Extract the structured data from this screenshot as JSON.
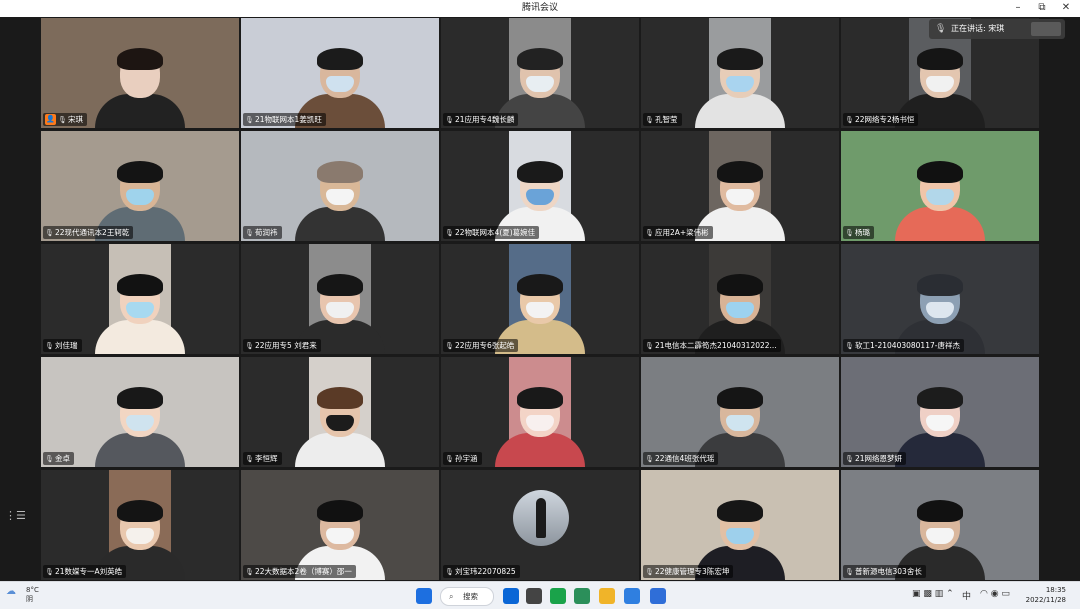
{
  "window": {
    "title": "腾讯会议",
    "controls": {
      "minimize": "–",
      "restore": "⧉",
      "close": "✕"
    }
  },
  "speaking_indicator": {
    "label": "正在讲话: 宋琪"
  },
  "participants": [
    {
      "name": "宋琪",
      "host": true,
      "bg": "#7d6b5b",
      "skin": "#e9cfbf",
      "hair": "#1d1512",
      "shirt": "#222",
      "mask": "",
      "layout": "full"
    },
    {
      "name": "21物联网本1姜凯旺",
      "bg": "#c9cdd6",
      "skin": "#d9b79d",
      "hair": "#1b1b1b",
      "shirt": "#6b4e3a",
      "mask": "#cfe1ef",
      "layout": "full"
    },
    {
      "name": "21应用专4魏长麟",
      "bg": "#8b8b8b",
      "skin": "#e0c3ad",
      "hair": "#222",
      "shirt": "#444",
      "mask": "#e8eef2",
      "layout": "narrow"
    },
    {
      "name": "孔智莹",
      "bg": "#9a9c9e",
      "skin": "#e7cdb8",
      "hair": "#1a1a1a",
      "shirt": "#e3e3e3",
      "mask": "#a9d4ef",
      "layout": "narrow"
    },
    {
      "name": "22网络专2杨书恒",
      "bg": "#5b5d60",
      "skin": "#e3c6b0",
      "hair": "#151515",
      "shirt": "#1f1f1f",
      "mask": "#f1f1f1",
      "layout": "narrow"
    },
    {
      "name": "22现代通讯本2王轲乾",
      "bg": "#a59b8f",
      "skin": "#d8b596",
      "hair": "#141414",
      "shirt": "#5f6c74",
      "mask": "#9fd3ec",
      "layout": "full"
    },
    {
      "name": "荀润祎",
      "bg": "#b5b9be",
      "skin": "#d9b898",
      "hair": "#8a7a6e",
      "shirt": "#333",
      "mask": "#f4f4f4",
      "layout": "full"
    },
    {
      "name": "22物联网本4(夏)葛婉佳",
      "bg": "#d8dbe0",
      "skin": "#eed6c5",
      "hair": "#1a1a1a",
      "shirt": "#f1f1f1",
      "mask": "#6aa3d8",
      "layout": "narrow"
    },
    {
      "name": "应用2A+梁伟彬",
      "bg": "#6d6660",
      "skin": "#e0bba0",
      "hair": "#141414",
      "shirt": "#f0f0f0",
      "mask": "#f4f4f4",
      "layout": "narrow"
    },
    {
      "name": "杨璐",
      "bg": "#6f9b6b",
      "skin": "#f0c5a9",
      "hair": "#111",
      "shirt": "#e66a58",
      "mask": "#b2d7ea",
      "layout": "full"
    },
    {
      "name": "刘佳瑞",
      "bg": "#c6bfb6",
      "skin": "#f0d2be",
      "hair": "#121212",
      "shirt": "#f3eadf",
      "mask": "#a7d9f0",
      "layout": "narrow"
    },
    {
      "name": "22应用专5 刘君来",
      "bg": "#8c8c8c",
      "skin": "#e8c5ae",
      "hair": "#161616",
      "shirt": "#2b2b2b",
      "mask": "#f0f0f0",
      "layout": "narrow"
    },
    {
      "name": "22应用专6张起皓",
      "bg": "#556c88",
      "skin": "#e9c9a9",
      "hair": "#191919",
      "shirt": "#d4bc8a",
      "mask": "#f3f3f3",
      "layout": "narrow"
    },
    {
      "name": "21电信本二霹笱杰21040312022...",
      "bg": "#3c3a38",
      "skin": "#d8b396",
      "hair": "#121212",
      "shirt": "#1f1f1f",
      "mask": "#9dd2ef",
      "layout": "narrow"
    },
    {
      "name": "软工1-210403080117-唐祥杰",
      "bg": "#37393d",
      "skin": "#8da0b4",
      "hair": "#2a2d33",
      "shirt": "#2e3035",
      "mask": "#dde6ef",
      "layout": "full"
    },
    {
      "name": "金卓",
      "bg": "#c7c4c0",
      "skin": "#f2d6c3",
      "hair": "#181818",
      "shirt": "#55585e",
      "mask": "#cfe3ef",
      "layout": "full"
    },
    {
      "name": "李恒辉",
      "bg": "#d5d0cb",
      "skin": "#e6c5ac",
      "hair": "#5a3a26",
      "shirt": "#ededed",
      "mask": "#1c1c1c",
      "layout": "narrow"
    },
    {
      "name": "孙宇涵",
      "bg": "#cc8c8e",
      "skin": "#f3d4c7",
      "hair": "#191919",
      "shirt": "#c8484e",
      "mask": "#f8f0ef",
      "layout": "narrow"
    },
    {
      "name": "22通信4班张代瑶",
      "bg": "#7b7e82",
      "skin": "#d8b79d",
      "hair": "#151515",
      "shirt": "#3b3c3e",
      "mask": "#cfe4ef",
      "layout": "full"
    },
    {
      "name": "21网络恩梦妍",
      "bg": "#6c6e76",
      "skin": "#efd0c6",
      "hair": "#1c1c1c",
      "shirt": "#25293a",
      "mask": "#f6f6f6",
      "layout": "full"
    },
    {
      "name": "21数媒专一A刘英皓",
      "bg": "#8a6b57",
      "skin": "#e9c8ae",
      "hair": "#141414",
      "shirt": "#2a2a2a",
      "mask": "#f5f1ec",
      "layout": "narrow"
    },
    {
      "name": "22大数据本2卷（博赛）邵一",
      "bg": "#4d4a47",
      "skin": "#ddb9a0",
      "hair": "#111",
      "shirt": "#f2f2f2",
      "mask": "#f5f5f5",
      "layout": "full"
    },
    {
      "name": "刘宝玮22070825",
      "bg": "#2b2b2b",
      "avatar": true,
      "layout": "avatar"
    },
    {
      "name": "22健康管理专3陈宏坤",
      "bg": "#c9c0b2",
      "skin": "#e2c0a5",
      "hair": "#161616",
      "shirt": "#1e1e24",
      "mask": "#9ed0ec",
      "layout": "full"
    },
    {
      "name": "普新源电信303舍长",
      "bg": "#7c7f84",
      "skin": "#d9b79d",
      "hair": "#111",
      "shirt": "#2a2a2a",
      "mask": "#f4f4f4",
      "layout": "full"
    }
  ],
  "left_menu": {
    "icon": "⋮☰"
  },
  "taskbar": {
    "weather_temp": "8°C",
    "weather_desc": "阴",
    "search_label": "搜索",
    "time": "18:35",
    "date": "2022/11/28",
    "ime": "中",
    "icon_colors": [
      "#0a66d6",
      "#444",
      "#1aa34a",
      "#2b8f5a",
      "#f0b429",
      "#2f7fe0",
      "#2f6ed8"
    ]
  }
}
